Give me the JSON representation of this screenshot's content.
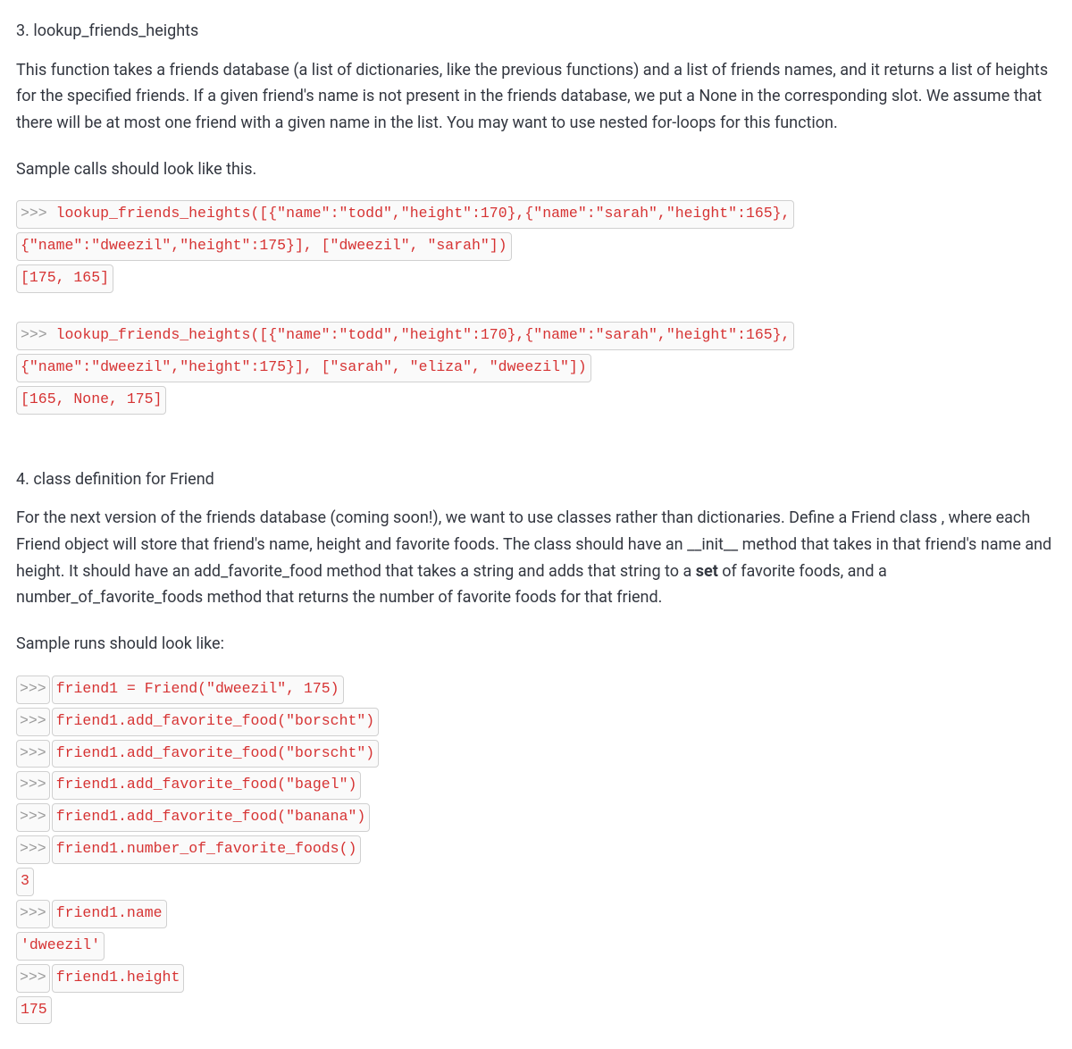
{
  "sections": [
    {
      "title": "3. lookup_friends_heights",
      "description": "This function takes a friends database (a list of dictionaries, like the previous functions) and a list of friends names, and it returns a list of heights for the specified friends. If a given friend's name is not present in the friends database, we put a None in the corresponding slot. We assume that there will be at most one friend with a given name in the list. You may want to use nested for-loops for this function.",
      "sample_intro": "Sample calls should look like this.",
      "code_blocks": [
        {
          "lines": [
            {
              "prompt": ">>>",
              "code": "lookup_friends_heights([{\"name\":\"todd\",\"height\":170},{\"name\":\"sarah\",\"height\":165},",
              "same_box": true
            },
            {
              "prompt": "",
              "code": "{\"name\":\"dweezil\",\"height\":175}], [\"dweezil\", \"sarah\"])"
            },
            {
              "prompt": "",
              "code": "[175, 165]"
            }
          ]
        },
        {
          "lines": [
            {
              "prompt": ">>>",
              "code": "lookup_friends_heights([{\"name\":\"todd\",\"height\":170},{\"name\":\"sarah\",\"height\":165},",
              "same_box": true
            },
            {
              "prompt": "",
              "code": "{\"name\":\"dweezil\",\"height\":175}], [\"sarah\", \"eliza\", \"dweezil\"])"
            },
            {
              "prompt": "",
              "code": "[165, None, 175]"
            }
          ]
        }
      ]
    },
    {
      "title": "4. class definition for Friend",
      "description": "For the next version of the friends database (coming soon!), we want to use classes rather than dictionaries.  Define a Friend class , where each Friend object will store that friend's name, height and favorite foods. The class should have an __init__ method that takes in that friend's name and height. It should have an add_favorite_food method that takes a string and adds that string to a set of favorite foods, and a number_of_favorite_foods method that returns the number of favorite foods for that friend.",
      "sample_intro": "Sample runs should look like:",
      "code_blocks": [
        {
          "lines": [
            {
              "prompt": ">>>",
              "code": "friend1 = Friend(\"dweezil\", 175)"
            },
            {
              "prompt": ">>>",
              "code": "friend1.add_favorite_food(\"borscht\")"
            },
            {
              "prompt": ">>>",
              "code": "friend1.add_favorite_food(\"borscht\")"
            },
            {
              "prompt": ">>>",
              "code": "friend1.add_favorite_food(\"bagel\")"
            },
            {
              "prompt": ">>>",
              "code": "friend1.add_favorite_food(\"banana\")"
            },
            {
              "prompt": ">>>",
              "code": "friend1.number_of_favorite_foods()"
            },
            {
              "prompt": "",
              "code": "3"
            },
            {
              "prompt": ">>>",
              "code": "friend1.name"
            },
            {
              "prompt": "",
              "code": "'dweezil'"
            },
            {
              "prompt": ">>>",
              "code": "friend1.height"
            },
            {
              "prompt": "",
              "code": "175"
            }
          ]
        }
      ]
    }
  ]
}
